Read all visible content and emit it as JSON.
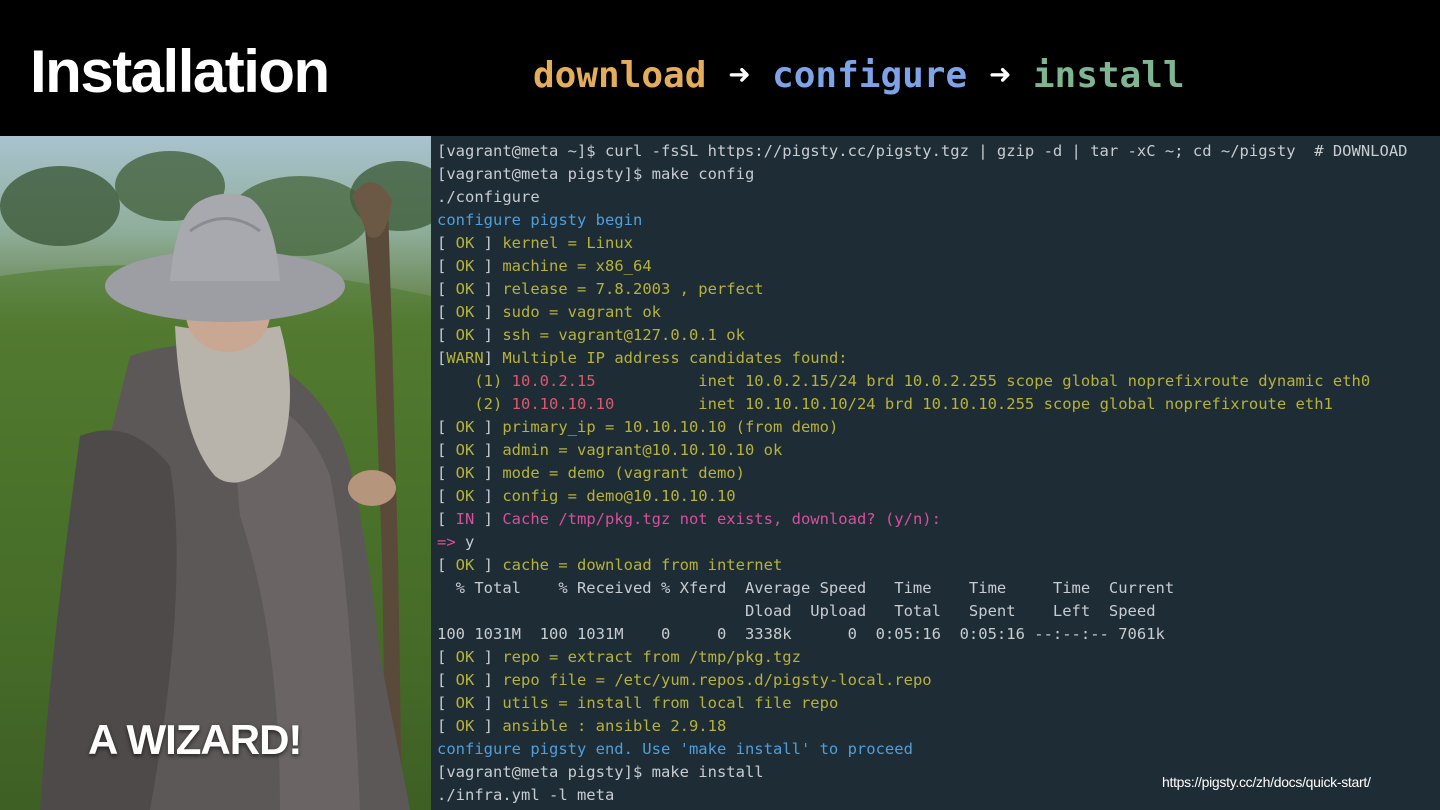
{
  "header": {
    "title": "Installation",
    "steps": [
      "download",
      "configure",
      "install"
    ],
    "arrow": "➜"
  },
  "wizard": {
    "caption": "A WIZARD!"
  },
  "terminal": {
    "lines": [
      [
        {
          "t": "[vagrant@meta ~]$ curl -fsSL https://pigsty.cc/pigsty.tgz | gzip -d | tar -xC ~; cd ~/pigsty  # DOWNLOAD",
          "c": "w"
        }
      ],
      [
        {
          "t": "[vagrant@meta pigsty]$ make config",
          "c": "w"
        }
      ],
      [
        {
          "t": "./configure",
          "c": "w"
        }
      ],
      [
        {
          "t": "configure pigsty begin",
          "c": "b"
        }
      ],
      [
        {
          "t": "[ ",
          "c": "w"
        },
        {
          "t": "OK",
          "c": "o"
        },
        {
          "t": " ] ",
          "c": "w"
        },
        {
          "t": "kernel = Linux",
          "c": "o"
        }
      ],
      [
        {
          "t": "[ ",
          "c": "w"
        },
        {
          "t": "OK",
          "c": "o"
        },
        {
          "t": " ] ",
          "c": "w"
        },
        {
          "t": "machine = x86_64",
          "c": "o"
        }
      ],
      [
        {
          "t": "[ ",
          "c": "w"
        },
        {
          "t": "OK",
          "c": "o"
        },
        {
          "t": " ] ",
          "c": "w"
        },
        {
          "t": "release = 7.8.2003 , perfect",
          "c": "o"
        }
      ],
      [
        {
          "t": "[ ",
          "c": "w"
        },
        {
          "t": "OK",
          "c": "o"
        },
        {
          "t": " ] ",
          "c": "w"
        },
        {
          "t": "sudo = vagrant ok",
          "c": "o"
        }
      ],
      [
        {
          "t": "[ ",
          "c": "w"
        },
        {
          "t": "OK",
          "c": "o"
        },
        {
          "t": " ] ",
          "c": "w"
        },
        {
          "t": "ssh = vagrant@127.0.0.1 ok",
          "c": "o"
        }
      ],
      [
        {
          "t": "[",
          "c": "w"
        },
        {
          "t": "WARN",
          "c": "o"
        },
        {
          "t": "] ",
          "c": "w"
        },
        {
          "t": "Multiple IP address candidates found:",
          "c": "o"
        }
      ],
      [
        {
          "t": "    (1) ",
          "c": "o"
        },
        {
          "t": "10.0.2.15",
          "c": "r"
        },
        {
          "t": "           inet 10.0.2.15/24 brd 10.0.2.255 scope global noprefixroute dynamic eth0",
          "c": "o"
        }
      ],
      [
        {
          "t": "    (2) ",
          "c": "o"
        },
        {
          "t": "10.10.10.10",
          "c": "r"
        },
        {
          "t": "         inet 10.10.10.10/24 brd 10.10.10.255 scope global noprefixroute eth1",
          "c": "o"
        }
      ],
      [
        {
          "t": "[ ",
          "c": "w"
        },
        {
          "t": "OK",
          "c": "o"
        },
        {
          "t": " ] ",
          "c": "w"
        },
        {
          "t": "primary_ip = 10.10.10.10 (from demo)",
          "c": "o"
        }
      ],
      [
        {
          "t": "[ ",
          "c": "w"
        },
        {
          "t": "OK",
          "c": "o"
        },
        {
          "t": " ] ",
          "c": "w"
        },
        {
          "t": "admin = vagrant@10.10.10.10 ok",
          "c": "o"
        }
      ],
      [
        {
          "t": "[ ",
          "c": "w"
        },
        {
          "t": "OK",
          "c": "o"
        },
        {
          "t": " ] ",
          "c": "w"
        },
        {
          "t": "mode = demo (vagrant demo)",
          "c": "o"
        }
      ],
      [
        {
          "t": "[ ",
          "c": "w"
        },
        {
          "t": "OK",
          "c": "o"
        },
        {
          "t": " ] ",
          "c": "w"
        },
        {
          "t": "config = demo@10.10.10.10",
          "c": "o"
        }
      ],
      [
        {
          "t": "[ ",
          "c": "w"
        },
        {
          "t": "IN",
          "c": "p"
        },
        {
          "t": " ] ",
          "c": "w"
        },
        {
          "t": "Cache /tmp/pkg.tgz not exists, download? (y/n):",
          "c": "p"
        }
      ],
      [
        {
          "t": "=> ",
          "c": "p"
        },
        {
          "t": "y",
          "c": "w"
        }
      ],
      [
        {
          "t": "[ ",
          "c": "w"
        },
        {
          "t": "OK",
          "c": "o"
        },
        {
          "t": " ] ",
          "c": "w"
        },
        {
          "t": "cache = download from internet",
          "c": "o"
        }
      ],
      [
        {
          "t": "  % Total    % Received % Xferd  Average Speed   Time    Time     Time  Current",
          "c": "w"
        }
      ],
      [
        {
          "t": "                                 Dload  Upload   Total   Spent    Left  Speed",
          "c": "w"
        }
      ],
      [
        {
          "t": "100 1031M  100 1031M    0     0  3338k      0  0:05:16  0:05:16 --:--:-- 7061k",
          "c": "w"
        }
      ],
      [
        {
          "t": "[ ",
          "c": "w"
        },
        {
          "t": "OK",
          "c": "o"
        },
        {
          "t": " ] ",
          "c": "w"
        },
        {
          "t": "repo = extract from /tmp/pkg.tgz",
          "c": "o"
        }
      ],
      [
        {
          "t": "[ ",
          "c": "w"
        },
        {
          "t": "OK",
          "c": "o"
        },
        {
          "t": " ] ",
          "c": "w"
        },
        {
          "t": "repo file = /etc/yum.repos.d/pigsty-local.repo",
          "c": "o"
        }
      ],
      [
        {
          "t": "[ ",
          "c": "w"
        },
        {
          "t": "OK",
          "c": "o"
        },
        {
          "t": " ] ",
          "c": "w"
        },
        {
          "t": "utils = install from local file repo",
          "c": "o"
        }
      ],
      [
        {
          "t": "[ ",
          "c": "w"
        },
        {
          "t": "OK",
          "c": "o"
        },
        {
          "t": " ] ",
          "c": "w"
        },
        {
          "t": "ansible : ansible 2.9.18",
          "c": "o"
        }
      ],
      [
        {
          "t": "configure pigsty end. Use 'make install' to proceed",
          "c": "b"
        }
      ],
      [
        {
          "t": "[vagrant@meta pigsty]$ make install",
          "c": "w"
        }
      ],
      [
        {
          "t": "./infra.yml -l meta",
          "c": "w"
        }
      ]
    ]
  },
  "footer": {
    "url": "https://pigsty.cc/zh/docs/quick-start/"
  }
}
